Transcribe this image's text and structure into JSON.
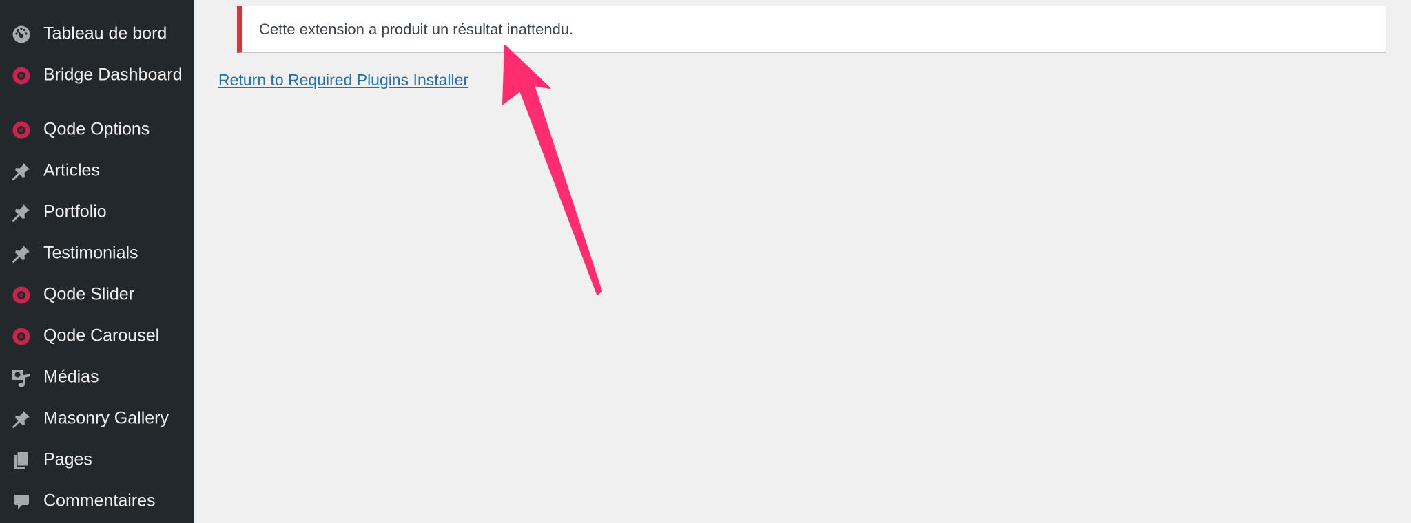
{
  "sidebar": {
    "items": [
      {
        "label": "Tableau de bord",
        "icon": "dashboard-gauge-icon"
      },
      {
        "label": "Bridge Dashboard",
        "icon": "qode-logo-icon"
      },
      {
        "label": "Qode Options",
        "icon": "qode-logo-icon"
      },
      {
        "label": "Articles",
        "icon": "pushpin-icon"
      },
      {
        "label": "Portfolio",
        "icon": "pushpin-icon"
      },
      {
        "label": "Testimonials",
        "icon": "pushpin-icon"
      },
      {
        "label": "Qode Slider",
        "icon": "qode-logo-icon"
      },
      {
        "label": "Qode Carousel",
        "icon": "qode-logo-icon"
      },
      {
        "label": "Médias",
        "icon": "media-icon"
      },
      {
        "label": "Masonry Gallery",
        "icon": "pushpin-icon"
      },
      {
        "label": "Pages",
        "icon": "pages-icon"
      },
      {
        "label": "Commentaires",
        "icon": "comment-bubble-icon"
      }
    ]
  },
  "main": {
    "notice_text": "Cette extension a produit un résultat inattendu.",
    "return_link": "Return to Required Plugins Installer"
  },
  "colors": {
    "sidebar_bg": "#23282d",
    "content_bg": "#f0f0f1",
    "notice_error_border": "#d63638",
    "link": "#2271b1",
    "qode_icon": "#c7254e",
    "annotation_arrow": "#ff2d6f"
  }
}
